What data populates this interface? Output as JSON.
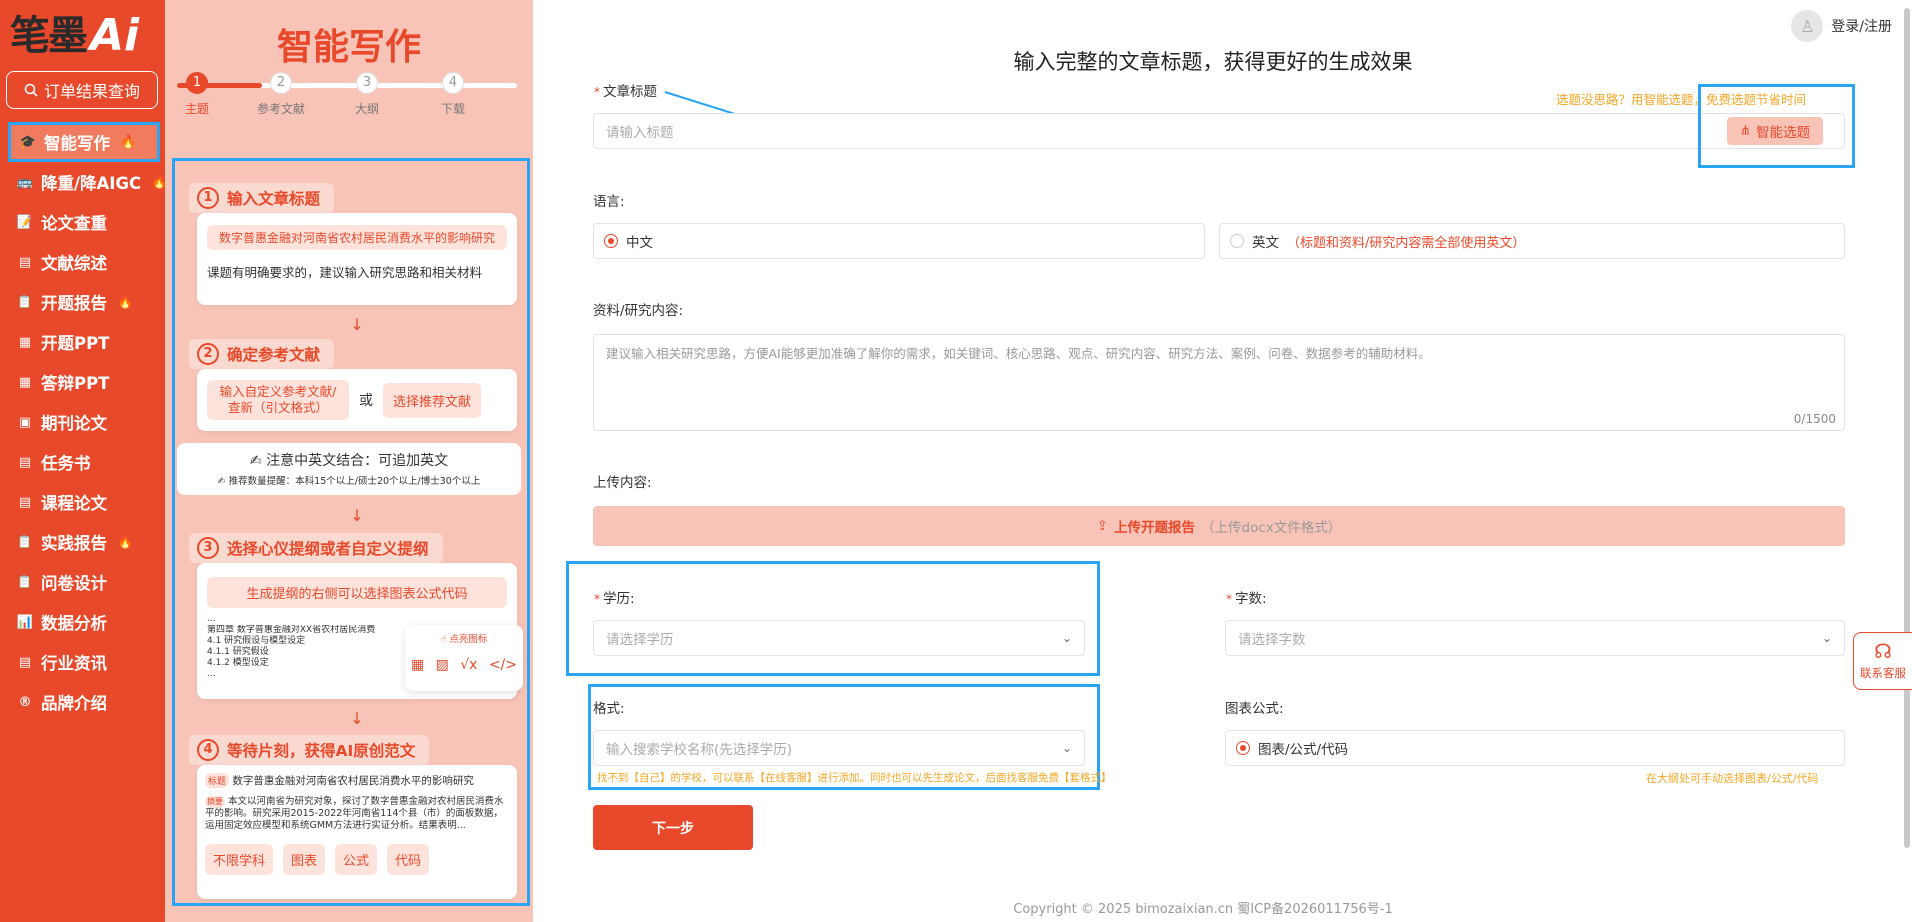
{
  "brand": {
    "logo_text": "笔墨",
    "logo_ai": "Ai"
  },
  "nav": {
    "order_query": "订单结果查询",
    "items": [
      {
        "label": "智能写作",
        "icon": "🎓",
        "fire": "🔥"
      },
      {
        "label": "降重/降AIGC",
        "icon": "🚌",
        "fire": "🔥"
      },
      {
        "label": "论文查重",
        "icon": "📝",
        "fire": ""
      },
      {
        "label": "文献综述",
        "icon": "▤",
        "fire": ""
      },
      {
        "label": "开题报告",
        "icon": "📋",
        "fire": "🔥"
      },
      {
        "label": "开题PPT",
        "icon": "▦",
        "fire": ""
      },
      {
        "label": "答辩PPT",
        "icon": "▦",
        "fire": ""
      },
      {
        "label": "期刊论文",
        "icon": "▣",
        "fire": ""
      },
      {
        "label": "任务书",
        "icon": "▤",
        "fire": ""
      },
      {
        "label": "课程论文",
        "icon": "▤",
        "fire": ""
      },
      {
        "label": "实践报告",
        "icon": "📋",
        "fire": "🔥"
      },
      {
        "label": "问卷设计",
        "icon": "📋",
        "fire": ""
      },
      {
        "label": "数据分析",
        "icon": "📊",
        "fire": ""
      },
      {
        "label": "行业资讯",
        "icon": "▤",
        "fire": ""
      },
      {
        "label": "品牌介绍",
        "icon": "®",
        "fire": ""
      }
    ]
  },
  "guide": {
    "title": "智能写作",
    "steps": [
      {
        "num": "1",
        "label": "主题"
      },
      {
        "num": "2",
        "label": "参考文献"
      },
      {
        "num": "3",
        "label": "大纲"
      },
      {
        "num": "4",
        "label": "下载"
      }
    ],
    "s1": {
      "num": "1",
      "head": "输入文章标题",
      "example": "数字普惠金融对河南省农村居民消费水平的影响研究",
      "tip": "课题有明确要求的，建议输入研究思路和相关材料"
    },
    "s2": {
      "num": "2",
      "head": "确定参考文献",
      "opt_a": "输入自定义参考文献/查新（引文格式）",
      "or": "或",
      "opt_b": "选择推荐文献",
      "note_title": "注意中英文结合：可追加英文",
      "note_sub": "推荐数量提醒：本科15个以上/硕士20个以上/博士30个以上"
    },
    "s3": {
      "num": "3",
      "head": "选择心仪提纲或者自定义提纲",
      "chip": "生成提纲的右侧可以选择图表公式代码",
      "outline": [
        "第四章 数字普惠金融对XX省农村居民消费",
        "4.1 研究假设与模型设定",
        "4.1.1 研究假设",
        "4.1.2 模型设定"
      ],
      "click_hint": "点亮图标"
    },
    "s4": {
      "num": "4",
      "head": "等待片刻，获得AI原创范文",
      "title_tag": "标题",
      "title_text": "数字普惠金融对河南省农村居民消费水平的影响研究",
      "abstract_tag": "摘要",
      "abstract_text": "本文以河南省为研究对象，探讨了数字普惠金融对农村居民消费水平的影响。研究采用2015-2022年河南省114个县（市）的面板数据，运用固定效应模型和系统GMM方法进行实证分析。结果表明...",
      "tags": [
        "不限学科",
        "图表",
        "公式",
        "代码"
      ]
    }
  },
  "header": {
    "login": "登录/注册"
  },
  "form": {
    "heading": "输入完整的文章标题，获得更好的生成效果",
    "title_label": "文章标题",
    "title_placeholder": "请输入标题",
    "smart_hint": "选题没思路？用智能选题，免费选题节省时间",
    "smart_button": "智能选题",
    "lang_label": "语言:",
    "lang_zh": "中文",
    "lang_en": "英文",
    "lang_en_note": "（标题和资料/研究内容需全部使用英文）",
    "material_label": "资料/研究内容:",
    "material_placeholder": "建议输入相关研究思路，方便AI能够更加准确了解你的需求，如关键词、核心思路、观点、研究内容、研究方法、案例、问卷、数据参考的辅助材料。",
    "material_count": "0/1500",
    "upload_label": "上传内容:",
    "upload_button": "上传开题报告",
    "upload_note": "（上传docx文件格式）",
    "degree_label": "学历:",
    "degree_placeholder": "请选择学历",
    "words_label": "字数:",
    "words_placeholder": "请选择字数",
    "format_label": "格式:",
    "format_placeholder": "输入搜索学校名称(先选择学历)",
    "format_hint": "找不到【自己】的学校，可以联系【在线客服】进行添加。同时也可以先生成论文，后面找客服免费【套格式】",
    "chart_label": "图表公式:",
    "chart_option": "图表/公式/代码",
    "chart_hint": "在大纲处可手动选择图表/公式/代码",
    "next_button": "下一步"
  },
  "service": {
    "label": "联系客服"
  },
  "footer": {
    "copyright": "Copyright © 2025 bimozaixian.cn 蜀ICP备2026011756号-1"
  },
  "colors": {
    "accent": "#e8492a",
    "guide_bg": "#f9c4b8",
    "highlight": "#2aa4f4",
    "hint": "#f5a623"
  }
}
